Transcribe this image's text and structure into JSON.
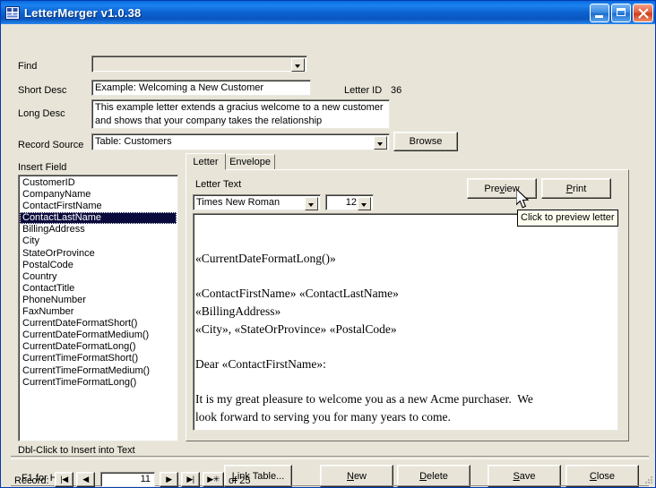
{
  "window": {
    "title": "LetterMerger v1.0.38",
    "icon": "form-grid-icon",
    "minimize_label": "Minimize",
    "maximize_label": "Maximize",
    "close_label": "Close",
    "titlebar_color": "#0c62cf",
    "form_background": "#e8e4d8"
  },
  "header": {
    "find_label": "Find",
    "find_value": "",
    "short_desc_label": "Short Desc",
    "short_desc_value": "Example: Welcoming a New Customer",
    "long_desc_label": "Long Desc",
    "long_desc_value": "This example letter extends a gracius welcome to a new customer and shows that your company takes the relationship",
    "letter_id_label": "Letter ID",
    "letter_id_value": "36",
    "record_source_label": "Record Source",
    "record_source_value": "Table: Customers",
    "browse_label": "Browse"
  },
  "insert_field": {
    "caption": "Insert Field",
    "hint": "Dbl-Click to Insert into Text",
    "selected_index": 3,
    "selection_color": "#0a0a3c",
    "items": [
      "CustomerID",
      "CompanyName",
      "ContactFirstName",
      "ContactLastName",
      "BillingAddress",
      "City",
      "StateOrProvince",
      "PostalCode",
      "Country",
      "ContactTitle",
      "PhoneNumber",
      "FaxNumber",
      "CurrentDateFormatShort()",
      "CurrentDateFormatMedium()",
      "CurrentDateFormatLong()",
      "CurrentTimeFormatShort()",
      "CurrentTimeFormatMedium()",
      "CurrentTimeFormatLong()"
    ]
  },
  "tabs": [
    {
      "label": "Letter",
      "active": true
    },
    {
      "label": "Envelope",
      "active": false
    }
  ],
  "letter_panel": {
    "letter_text_label": "Letter Text",
    "font_name_value": "Times New Roman",
    "font_size_value": "12",
    "preview_label_pre": "Pre",
    "preview_label_accel": "v",
    "preview_label_post": "iew",
    "print_label_accel": "P",
    "print_label_post": "rint",
    "body": "\n\n«CurrentDateFormatLong()»\n\n«ContactFirstName» «ContactLastName»\n«BillingAddress»\n«City», «StateOrProvince» «PostalCode»\n\nDear «ContactFirstName»:\n\nIt is my great pleasure to welcome you as a new Acme purchaser.  We\nlook forward to serving you for many years to come."
  },
  "tooltip": {
    "text": "Click to preview letter"
  },
  "footer": {
    "help_text": "F1 for Help",
    "buttons": [
      {
        "name": "link-table",
        "pre": "",
        "accel": "L",
        "post": "ink Table..."
      },
      {
        "name": "new",
        "pre": "",
        "accel": "N",
        "post": "ew"
      },
      {
        "name": "delete",
        "pre": "",
        "accel": "D",
        "post": "elete"
      },
      {
        "name": "save",
        "pre": "",
        "accel": "S",
        "post": "ave"
      },
      {
        "name": "close",
        "pre": "",
        "accel": "C",
        "post": "lose"
      }
    ]
  },
  "record_nav": {
    "label": "Record:",
    "first_glyph": "|◀",
    "prev_glyph": "◀",
    "current": "11",
    "next_glyph": "▶",
    "last_glyph": "▶|",
    "new_glyph": "▶✳",
    "of_text": "of  25"
  }
}
